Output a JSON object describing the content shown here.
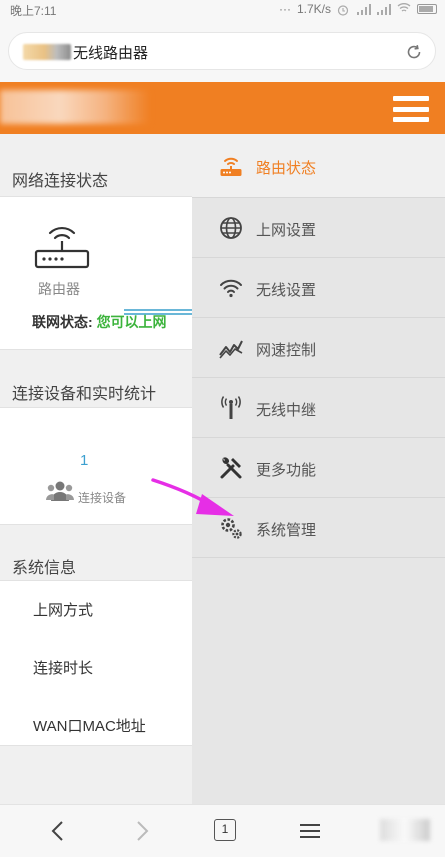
{
  "status_bar": {
    "time": "晚上7:11",
    "dots": "···",
    "speed": "1.7K/s"
  },
  "browser": {
    "page_title": "无线路由器",
    "tab_count": "1"
  },
  "left_page": {
    "section_network": "网络连接状态",
    "router_label": "路由器",
    "net_status_label": "联网状态:",
    "net_status_value": "您可以上网",
    "section_devices": "连接设备和实时统计",
    "device_count": "1",
    "device_label": "连接设备",
    "section_system": "系统信息",
    "info_items": [
      "上网方式",
      "连接时长",
      "WAN口MAC地址"
    ]
  },
  "menu": {
    "items": [
      {
        "label": "路由状态",
        "icon": "router-icon",
        "active": true
      },
      {
        "label": "上网设置",
        "icon": "globe-icon",
        "active": false
      },
      {
        "label": "无线设置",
        "icon": "wifi-icon",
        "active": false
      },
      {
        "label": "网速控制",
        "icon": "speed-chart-icon",
        "active": false
      },
      {
        "label": "无线中继",
        "icon": "antenna-icon",
        "active": false
      },
      {
        "label": "更多功能",
        "icon": "tools-icon",
        "active": false
      },
      {
        "label": "系统管理",
        "icon": "gears-icon",
        "active": false
      }
    ]
  },
  "colors": {
    "brand_orange": "#f07f22",
    "status_green": "#3cb33c",
    "annotation_magenta": "#e62ee6",
    "link_blue": "#3ca0d0"
  }
}
